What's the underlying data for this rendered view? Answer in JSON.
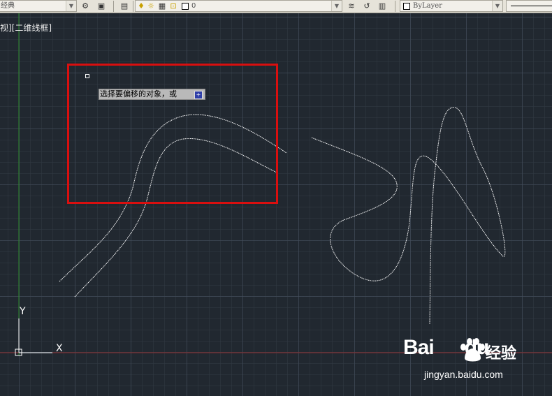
{
  "toolbar": {
    "workspace_value": "经典",
    "layer_value": "0",
    "color_value": "ByLayer"
  },
  "viewport": {
    "view_label": "视][二维线框]",
    "command_prompt": "选择要偏移的对象，或",
    "prompt_button": "+"
  },
  "ucs": {
    "x_label": "X",
    "y_label": "Y"
  },
  "watermark": {
    "logo": "Bai",
    "logo_tail": "du",
    "product": "经验",
    "url": "jingyan.baidu.com"
  },
  "colors": {
    "canvas": "#212830",
    "highlight": "#d90f0f",
    "curve": "#ffffff",
    "y_axis_line": "#2f8a2f",
    "x_axis_line": "#8a2a2a"
  }
}
